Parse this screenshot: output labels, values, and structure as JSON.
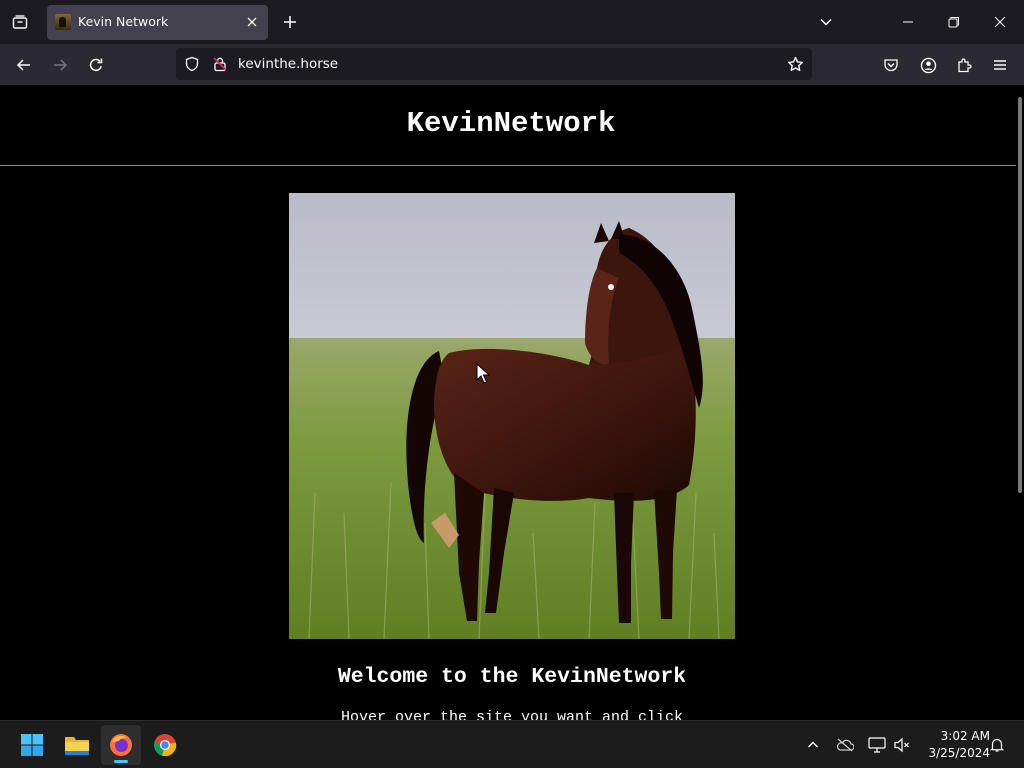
{
  "browser": {
    "tab": {
      "title": "Kevin Network",
      "favicon": "horse-favicon"
    },
    "address": {
      "url": "kevinthe.horse"
    },
    "icons": {
      "tab_list": "tab-list-icon",
      "close": "close-icon",
      "new_tab": "plus-icon",
      "list_all_tabs": "chevron-down-icon",
      "minimize": "minimize-icon",
      "restore": "restore-icon",
      "window_close": "close-icon",
      "back": "back-arrow-icon",
      "forward": "forward-arrow-icon",
      "reload": "reload-icon",
      "shield": "shield-icon",
      "permissions": "permissions-icon",
      "bookmark": "star-icon",
      "pocket": "pocket-icon",
      "account": "account-icon",
      "extensions": "puzzle-icon",
      "menu": "hamburger-icon"
    },
    "colors": {
      "tabstrip": "#1c1b22",
      "toolbar": "#2b2a33",
      "active_tab": "#42414d",
      "urlbar": "#1c1b22"
    }
  },
  "page": {
    "site_title": "KevinNetwork",
    "hero_image": "horse-photo",
    "welcome": "Welcome to the KevinNetwork",
    "instruction": "Hover over the site you want and click"
  },
  "taskbar": {
    "apps": [
      "windows-start-icon",
      "file-explorer-icon",
      "firefox-icon",
      "chrome-icon"
    ],
    "tray": [
      "chevron-up-icon",
      "onedrive-icon",
      "network-icon",
      "volume-muted-icon",
      "notification-bell-icon"
    ],
    "clock": {
      "time": "3:02 AM",
      "date": "3/25/2024"
    },
    "accent": "#4cc2ff"
  }
}
